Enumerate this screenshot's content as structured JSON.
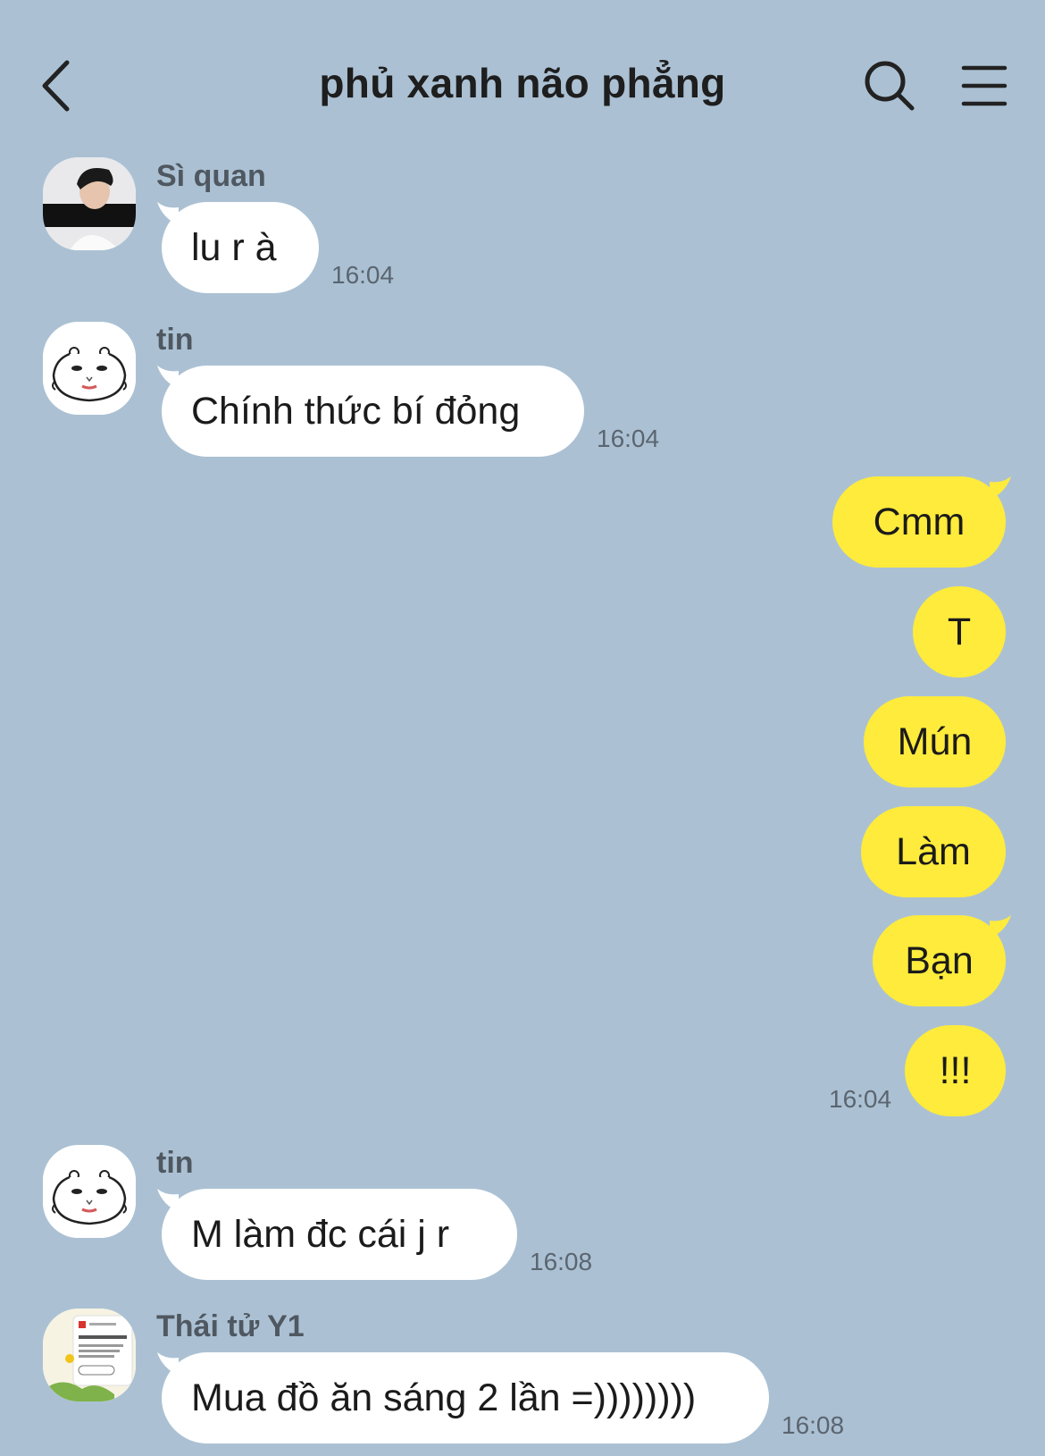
{
  "header": {
    "title": "phủ xanh não phẳng"
  },
  "colors": {
    "background": "#abc1d3",
    "incoming_bubble": "#ffffff",
    "outgoing_bubble": "#ffeb3b",
    "sender_text": "#4f5861",
    "time_text": "#5b6570"
  },
  "icons": [
    "back-arrow-icon",
    "search-icon",
    "menu-icon"
  ],
  "messages": [
    {
      "sender": "Sì quan",
      "text": "lu r à",
      "time": "16:04"
    },
    {
      "sender": "tin",
      "text": "Chính thức bí đỏng",
      "time": "16:04"
    },
    {
      "text": "Cmm"
    },
    {
      "text": "T"
    },
    {
      "text": "Mún"
    },
    {
      "text": "Làm"
    },
    {
      "text": "Bạn"
    },
    {
      "text": "!!!",
      "time": "16:04"
    },
    {
      "sender": "tin",
      "text": "M làm đc cái j r",
      "time": "16:08"
    },
    {
      "sender": "Thái tử Y1",
      "text": "Mua đồ ăn sáng 2 lần =))))))))",
      "time": "16:08"
    }
  ]
}
